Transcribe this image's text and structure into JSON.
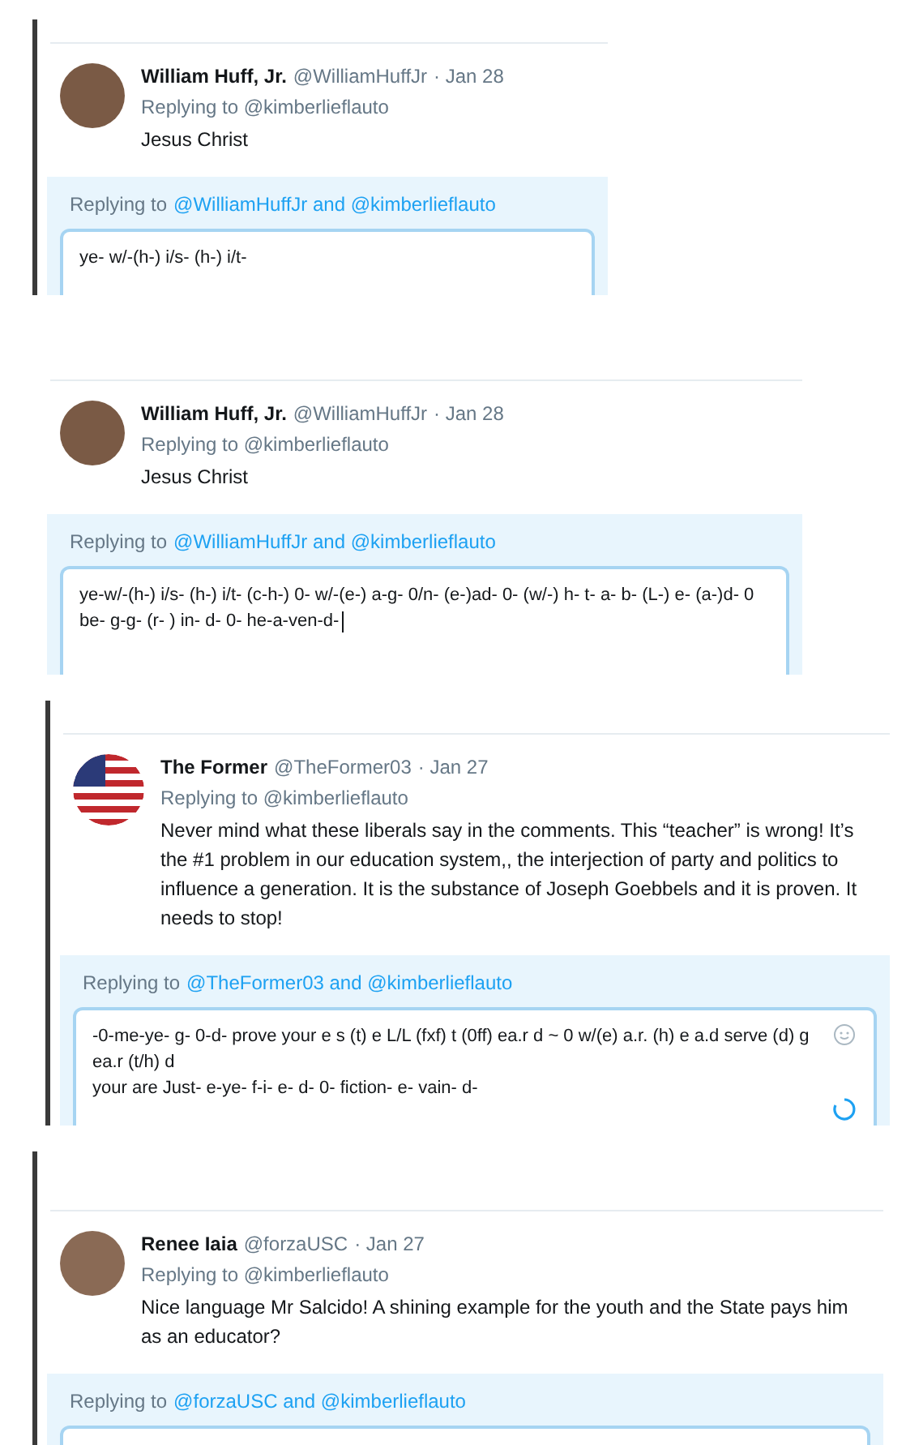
{
  "panels": [
    {
      "left_bar": true,
      "tweet": {
        "name": "William Huff, Jr.",
        "handle": "@WilliamHuffJr",
        "date": "· Jan 28",
        "replying_to": "Replying to @kimberlieflauto",
        "body": "Jesus Christ",
        "avatar": {
          "kind": "photo"
        }
      },
      "reply": {
        "prefix": "Replying to",
        "mentions": "@WilliamHuffJr and @kimberlieflauto",
        "lines": [
          "ye- w/-(h-) i/s- (h-) i/t-"
        ]
      }
    },
    {
      "left_bar": false,
      "tweet": {
        "name": "William Huff, Jr.",
        "handle": "@WilliamHuffJr",
        "date": "· Jan 28",
        "replying_to": "Replying to @kimberlieflauto",
        "body": "Jesus Christ",
        "avatar": {
          "kind": "photo"
        }
      },
      "reply": {
        "prefix": "Replying to",
        "mentions": "@WilliamHuffJr and @kimberlieflauto",
        "lines": [
          "ye-w/-(h-) i/s- (h-) i/t- (c-h-) 0- w/-(e-) a-g- 0/n- (e-)ad- 0- (w/-) h- t- a- b- (L-) e- (a-)d- 0 be- g-g- (r- ) in- d-  0- he-a-ven-d-"
        ],
        "cursor": true
      }
    },
    {
      "left_bar": true,
      "tweet": {
        "name": "The Former",
        "handle": "@TheFormer03",
        "date": "· Jan 27",
        "replying_to": "Replying to @kimberlieflauto",
        "body": "Never mind what these liberals say in the comments. This “teacher” is wrong! It’s the #1 problem in our education system,, the interjection  of party and politics to influence a generation. It is the substance of Joseph Goebbels and it is proven. It needs to stop!",
        "avatar": {
          "kind": "flag"
        }
      },
      "reply": {
        "prefix": "Replying to",
        "mentions": "@TheFormer03 and @kimberlieflauto",
        "lines": [
          "-0-me-ye- g- 0-d-  prove your e s (t) e L/L (fxf) t (0ff) ea.r  d  ~ 0 w/(e) a.r. (h) e a.d  serve (d) g ea.r (t/h) d",
          "your are Just- e-ye- f-i- e- d- 0- fiction- e- vain- d-"
        ],
        "emoji": true,
        "spinner": true
      }
    },
    {
      "left_bar": true,
      "tweet": {
        "name": "Renee Iaia",
        "handle": "@forzaUSC",
        "date": "· Jan 27",
        "replying_to": "Replying to @kimberlieflauto",
        "body": "Nice language Mr Salcido! A shining example for the youth and the State pays him as an educator?",
        "avatar": {
          "kind": "photo"
        }
      },
      "reply": {
        "prefix": "Replying to",
        "mentions": "@forzaUSC and @kimberlieflauto"
      }
    }
  ]
}
